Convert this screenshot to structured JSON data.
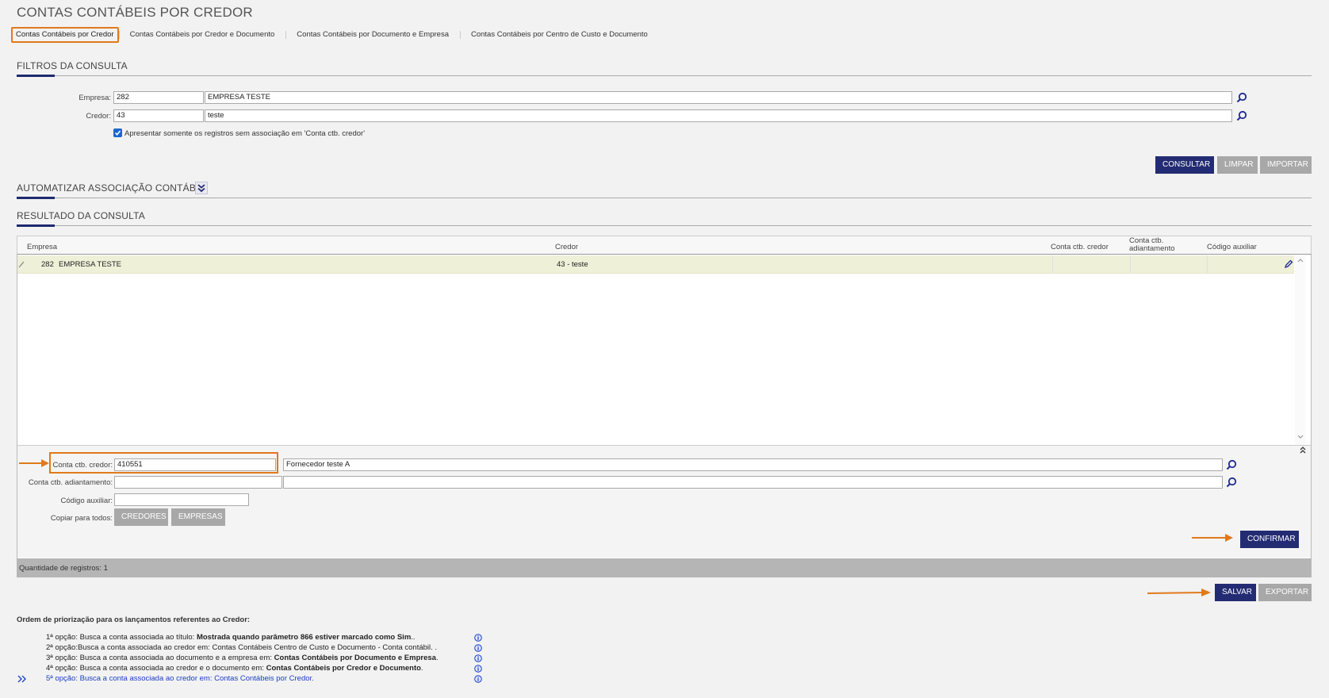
{
  "page": {
    "title": "CONTAS CONTÁBEIS POR CREDOR"
  },
  "tabs": [
    {
      "label": "Contas Contábeis por Credor",
      "active": true
    },
    {
      "label": "Contas Contábeis por Credor e Documento"
    },
    {
      "label": "Contas Contábeis por Documento e Empresa"
    },
    {
      "label": "Contas Contábeis por Centro de Custo e Documento"
    }
  ],
  "filters": {
    "title": "FILTROS DA CONSULTA",
    "empresa": {
      "label": "Empresa:",
      "code": "282",
      "name": "EMPRESA TESTE"
    },
    "credor": {
      "label": "Credor:",
      "code": "43",
      "name": "teste"
    },
    "checkbox_label": "Apresentar somente os registros sem associação em 'Conta ctb. credor'",
    "checkbox_checked": true
  },
  "actions": {
    "consultar": "CONSULTAR",
    "limpar": "LIMPAR",
    "importar": "IMPORTAR"
  },
  "automatizar": {
    "title": "AUTOMATIZAR ASSOCIAÇÃO CONTÁBIL"
  },
  "result": {
    "title": "RESULTADO DA CONSULTA",
    "columns": [
      "Empresa",
      "Credor",
      "Conta ctb. credor",
      "Conta ctb. adiantamento",
      "Código auxiliar"
    ],
    "rows": [
      {
        "empresa_code": "282",
        "empresa_name": "EMPRESA TESTE",
        "credor": "43 - teste",
        "conta_credor": "",
        "conta_adiantamento": "",
        "codigo_auxiliar": ""
      }
    ],
    "count_label": "Quantidade de registros: 1"
  },
  "edit": {
    "conta_credor": {
      "label": "Conta ctb. credor:",
      "code": "410551",
      "name": "Fornecedor teste A"
    },
    "conta_adiantamento": {
      "label": "Conta ctb. adiantamento:",
      "code": "",
      "name": ""
    },
    "codigo_auxiliar": {
      "label": "Código auxiliar:",
      "value": ""
    },
    "copiar_label": "Copiar para todos:",
    "credores_btn": "CREDORES",
    "empresas_btn": "EMPRESAS",
    "confirmar_btn": "CONFIRMAR"
  },
  "bottom_actions": {
    "salvar": "SALVAR",
    "exportar": "EXPORTAR"
  },
  "priority": {
    "title": "Ordem de priorização para os lançamentos referentes ao Credor:",
    "options": [
      {
        "prefix": "1ª opção:",
        "text": " Busca a conta associada ao título: ",
        "bold": "Mostrada quando parâmetro 866 estiver marcado como Sim",
        "suffix": ".."
      },
      {
        "prefix": "2ª opção:",
        "text": "Busca a conta associada ao credor em: Contas Contábeis Centro de Custo e Documento - Conta contábil. .",
        "bold": "",
        "suffix": ""
      },
      {
        "prefix": "3ª opção:",
        "text": " Busca a conta associada ao documento e a empresa em: ",
        "bold": "Contas Contábeis por Documento e Empresa",
        "suffix": "."
      },
      {
        "prefix": "4ª opção:",
        "text": " Busca a conta associada ao credor e o documento em: ",
        "bold": "Contas Contábeis por Credor e Documento",
        "suffix": "."
      },
      {
        "prefix": "5ª opção:",
        "text": " Busca a conta associada ao credor em: Contas Contábeis por Credor",
        "bold": "",
        "suffix": ".",
        "highlighted": true
      }
    ]
  },
  "colors": {
    "primary": "#232c72",
    "accent": "#e07a1c",
    "row_highlight": "#eff0d8",
    "link": "#1a3dc4"
  }
}
